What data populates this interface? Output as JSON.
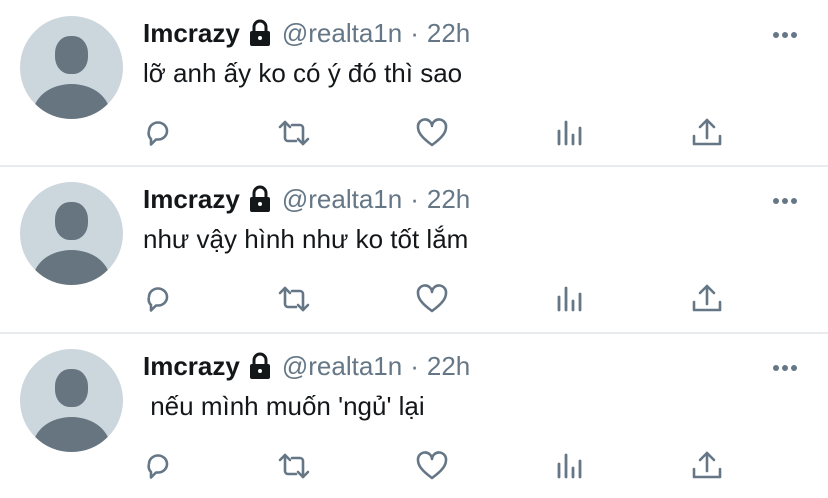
{
  "tweets": [
    {
      "name": "Imcrazy",
      "handle": "@realta1n",
      "separator": "·",
      "time": "22h",
      "text": "lỡ anh ấy ko có ý đó thì sao"
    },
    {
      "name": "Imcrazy",
      "handle": "@realta1n",
      "separator": "·",
      "time": "22h",
      "text": "như vậy hình như ko tốt lắm"
    },
    {
      "name": "Imcrazy",
      "handle": "@realta1n",
      "separator": "·",
      "time": "22h",
      "text": " nếu mình muốn 'ngủ' lại"
    }
  ],
  "icons": {
    "lock": "lock-icon",
    "more": "more-icon",
    "reply": "reply-icon",
    "retweet": "retweet-icon",
    "like": "heart-icon",
    "stats": "stats-icon",
    "share": "share-icon"
  },
  "colors": {
    "icon": "#657786",
    "text": "#14171a",
    "secondary": "#657786",
    "avatar_bg": "#ccd6dd",
    "avatar_fg": "#66757f",
    "divider": "#e8ecef"
  }
}
